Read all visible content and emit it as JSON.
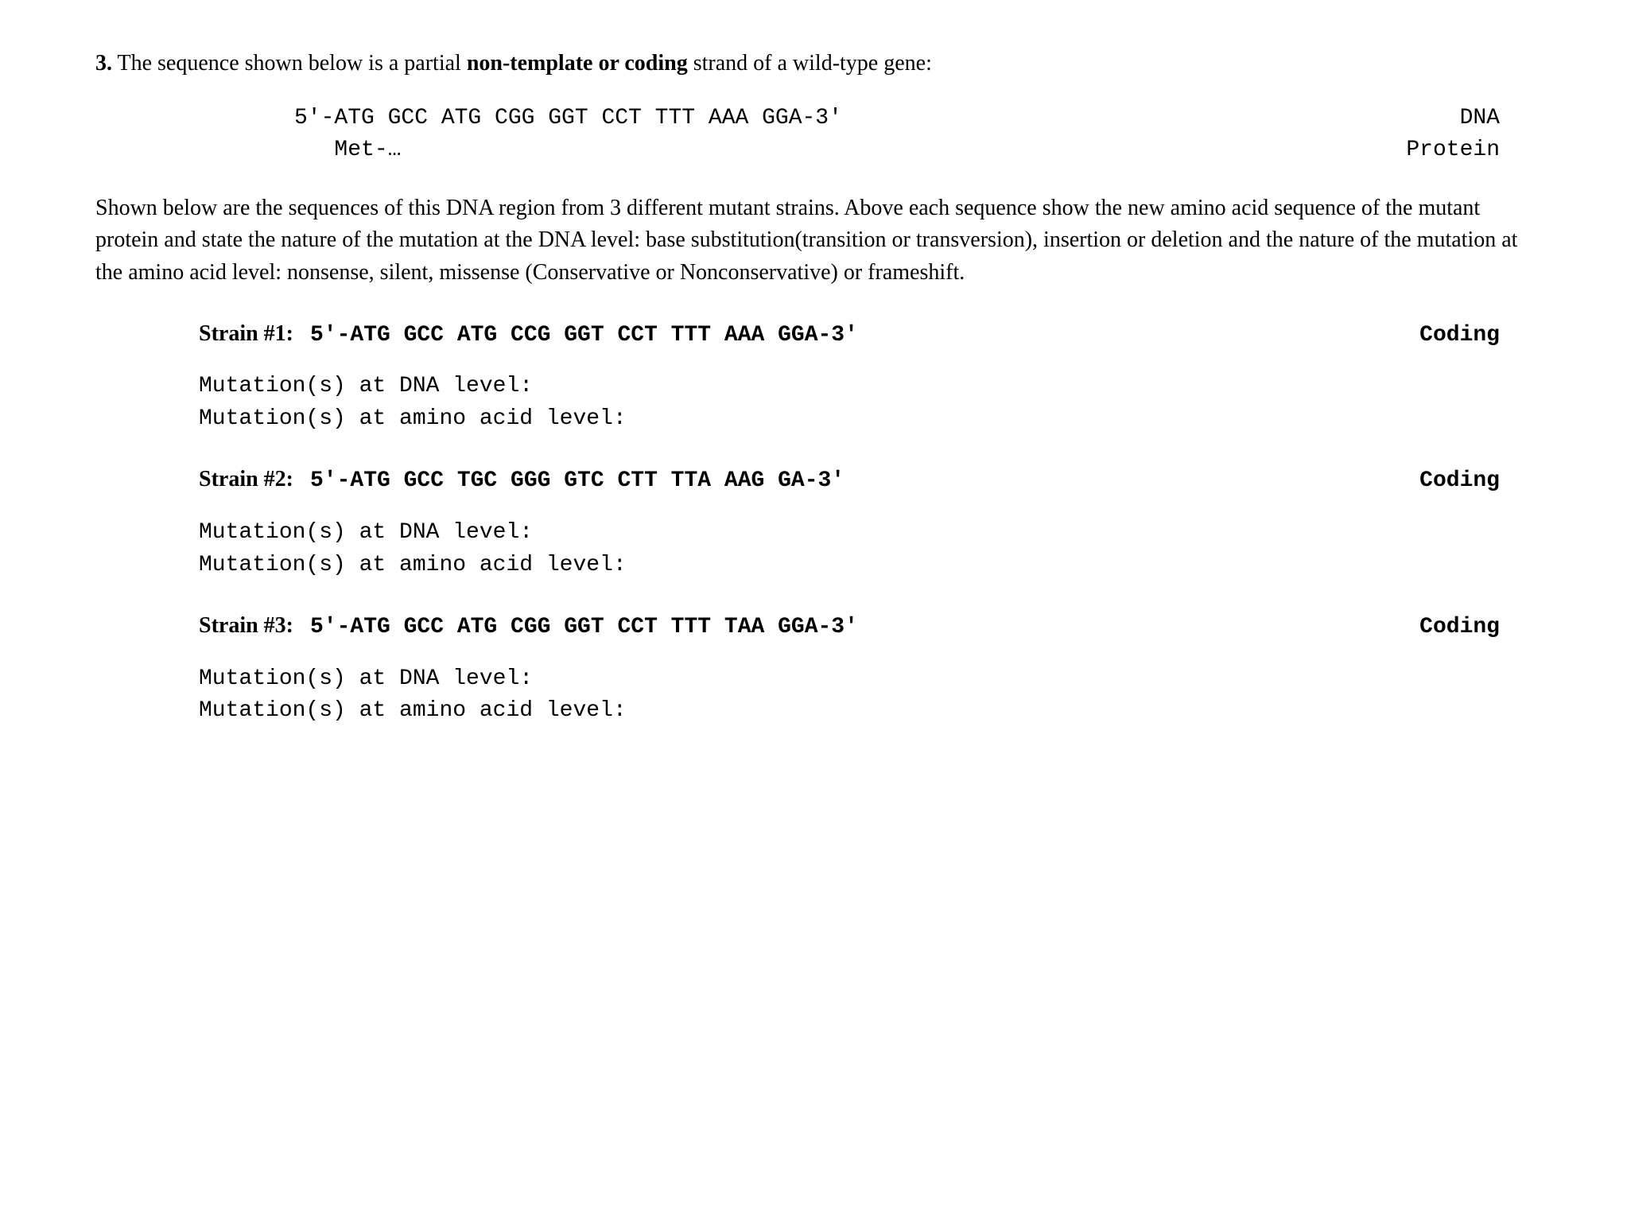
{
  "question": {
    "number": "3.",
    "intro_before_bold": " The sequence shown below is a partial ",
    "intro_bold": "non-template or coding",
    "intro_after_bold": " strand of a wild-type gene:"
  },
  "wildtype": {
    "dna_line": "5'-ATG GCC ATG CGG GGT CCT TTT AAA GGA-3'",
    "dna_label": "DNA",
    "protein_line": "   Met-…",
    "protein_label": "Protein"
  },
  "instructions": "Shown below are the sequences of this DNA region from 3 different mutant strains. Above each sequence show the new amino acid sequence of the mutant protein and state the nature of the mutation at the DNA level: base substitution(transition or transversion), insertion or deletion and the nature of the mutation at the amino acid level: nonsense, silent, missense (Conservative or Nonconservative) or frameshift.",
  "strains": [
    {
      "label": "Strain #1:",
      "sequence": "5'-ATG GCC ATG CCG GGT CCT TTT AAA GGA-3'",
      "coding_label": "Coding",
      "mutation_dna": "Mutation(s) at DNA level:",
      "mutation_aa": "Mutation(s) at amino acid level:"
    },
    {
      "label": "Strain #2:",
      "sequence": "5'-ATG GCC TGC GGG GTC CTT TTA AAG GA-3'",
      "coding_label": "Coding",
      "mutation_dna": "Mutation(s) at DNA level:",
      "mutation_aa": "Mutation(s) at amino acid level:"
    },
    {
      "label": "Strain #3:",
      "sequence": "5'-ATG GCC ATG CGG GGT CCT TTT TAA GGA-3'",
      "coding_label": "Coding",
      "mutation_dna": "Mutation(s) at DNA level:",
      "mutation_aa": "Mutation(s) at amino acid level:"
    }
  ]
}
